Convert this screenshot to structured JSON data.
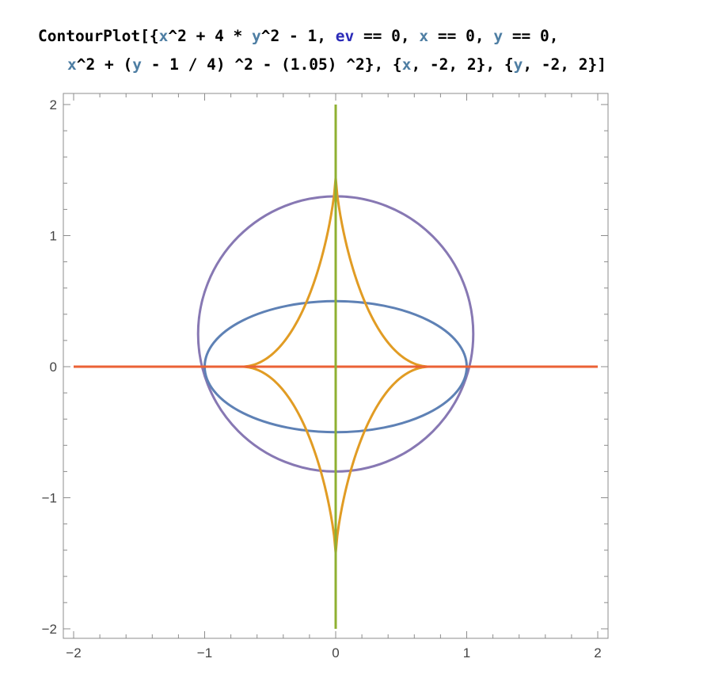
{
  "input": {
    "line1": [
      {
        "t": "ContourPlot[{",
        "c": "plain"
      },
      {
        "t": "x",
        "c": "var"
      },
      {
        "t": "^2 + 4 * ",
        "c": "plain"
      },
      {
        "t": "y",
        "c": "var"
      },
      {
        "t": "^2 - 1, ",
        "c": "plain"
      },
      {
        "t": "ev",
        "c": "sym"
      },
      {
        "t": " == 0, ",
        "c": "plain"
      },
      {
        "t": "x",
        "c": "var"
      },
      {
        "t": " == 0, ",
        "c": "plain"
      },
      {
        "t": "y",
        "c": "var"
      },
      {
        "t": " == 0,",
        "c": "plain"
      }
    ],
    "line2": [
      {
        "t": "x",
        "c": "var"
      },
      {
        "t": "^2 + (",
        "c": "plain"
      },
      {
        "t": "y",
        "c": "var"
      },
      {
        "t": " - 1 / 4) ^2 - (1.05) ^2}, {",
        "c": "plain"
      },
      {
        "t": "x",
        "c": "var"
      },
      {
        "t": ", -2, 2}, {",
        "c": "plain"
      },
      {
        "t": "y",
        "c": "var"
      },
      {
        "t": ", -2, 2}]",
        "c": "plain"
      }
    ]
  },
  "chart_data": {
    "type": "contour",
    "xlim": [
      -2,
      2
    ],
    "ylim": [
      -2,
      2
    ],
    "x_ticks": [
      "−2",
      "−1",
      "0",
      "1",
      "2"
    ],
    "y_ticks": [
      "−2",
      "−1",
      "0",
      "1",
      "2"
    ],
    "x_tick_values": [
      -2,
      -1,
      0,
      1,
      2
    ],
    "y_tick_values": [
      -2,
      -1,
      0,
      1,
      2
    ],
    "frame": true,
    "grid": false,
    "series": [
      {
        "expr": "x^2 + 4*y^2 - 1 = 0",
        "kind": "ellipse",
        "center": [
          0,
          0
        ],
        "rx": 1,
        "ry": 0.5,
        "color": "#5e81b5"
      },
      {
        "expr": "ev = 0",
        "kind": "astroid-like",
        "x_cusp": 0.72,
        "y_top": 1.44,
        "y_bottom": -1.42,
        "color": "#e19c24"
      },
      {
        "expr": "x = 0",
        "kind": "vline",
        "x": 0,
        "color": "#8fb032"
      },
      {
        "expr": "y = 0",
        "kind": "hline",
        "y": 0,
        "color": "#eb6235"
      },
      {
        "expr": "x^2 + (y - 1/4)^2 - (1.05)^2 = 0",
        "kind": "circle",
        "center": [
          0,
          0.25
        ],
        "r": 1.05,
        "color": "#8778b3"
      }
    ]
  }
}
